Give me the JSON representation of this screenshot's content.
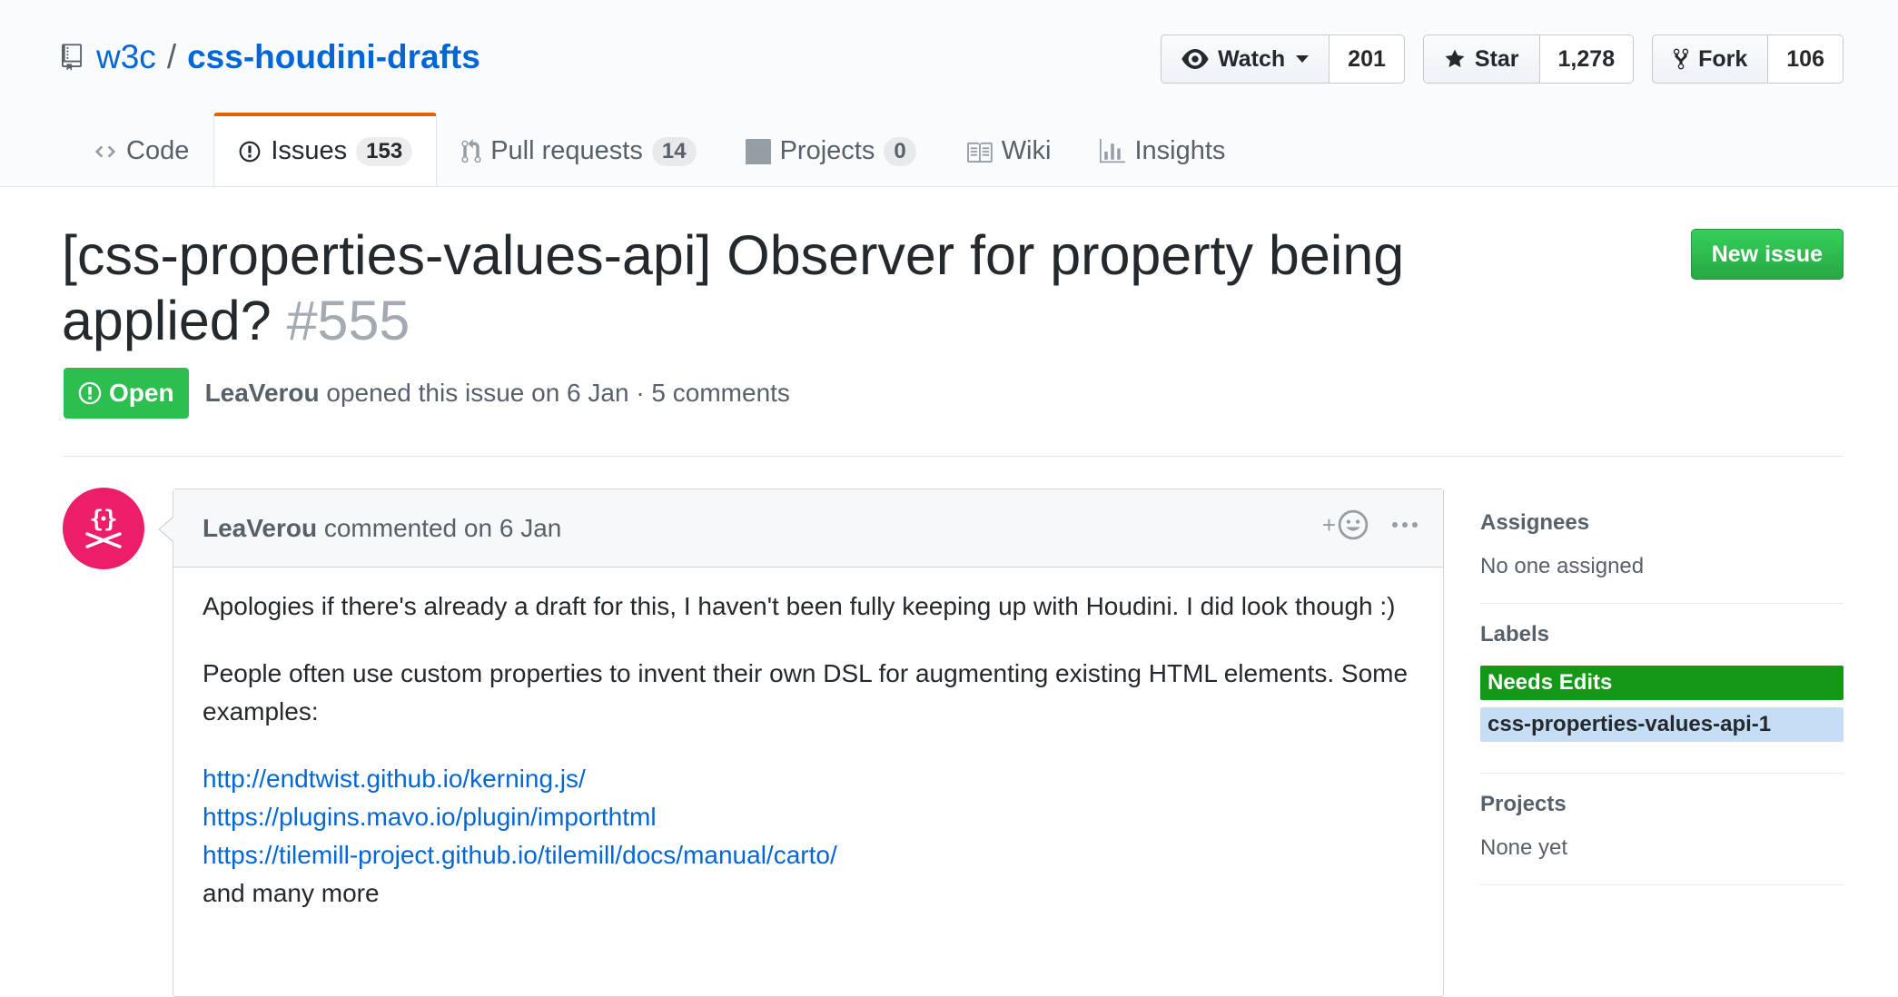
{
  "repo": {
    "owner": "w3c",
    "separator": "/",
    "name": "css-houdini-drafts"
  },
  "actions": {
    "watch": {
      "label": "Watch",
      "count": "201",
      "icon": "eye-icon"
    },
    "star": {
      "label": "Star",
      "count": "1,278",
      "icon": "star-icon"
    },
    "fork": {
      "label": "Fork",
      "count": "106",
      "icon": "fork-icon"
    }
  },
  "tabs": [
    {
      "label": "Code",
      "count": null,
      "icon": "code-icon",
      "selected": false
    },
    {
      "label": "Issues",
      "count": "153",
      "icon": "issue-opened-icon",
      "selected": true
    },
    {
      "label": "Pull requests",
      "count": "14",
      "icon": "pull-request-icon",
      "selected": false
    },
    {
      "label": "Projects",
      "count": "0",
      "icon": "project-icon",
      "selected": false
    },
    {
      "label": "Wiki",
      "count": null,
      "icon": "book-icon",
      "selected": false
    },
    {
      "label": "Insights",
      "count": null,
      "icon": "graph-icon",
      "selected": false
    }
  ],
  "issue": {
    "title": "[css-properties-values-api] Observer for property being applied?",
    "number": "#555",
    "state": "Open",
    "author": "LeaVerou",
    "meta_rest": "opened this issue on 6 Jan · 5 comments",
    "new_issue_label": "New issue"
  },
  "comment": {
    "author": "LeaVerou",
    "meta": "commented on 6 Jan",
    "reaction_plus": "+",
    "paragraphs": [
      "Apologies if there's already a draft for this, I haven't been fully keeping up with Houdini. I did look though :)",
      "People often use custom properties to invent their own DSL for augmenting existing HTML elements. Some examples:"
    ],
    "links": [
      "http://endtwist.github.io/kerning.js/",
      "https://plugins.mavo.io/plugin/importhtml",
      "https://tilemill-project.github.io/tilemill/docs/manual/carto/"
    ],
    "trailing": "and many more"
  },
  "sidebar": {
    "assignees": {
      "heading": "Assignees",
      "value": "No one assigned"
    },
    "labels": {
      "heading": "Labels",
      "items": [
        {
          "name": "Needs Edits",
          "bg": "#159818",
          "fg": "#ffffff"
        },
        {
          "name": "css-properties-values-api-1",
          "bg": "#c5def5",
          "fg": "#24292e"
        }
      ]
    },
    "projects": {
      "heading": "Projects",
      "value": "None yet"
    }
  },
  "colors": {
    "link": "#0366d6",
    "open_green": "#2cbe4e",
    "selected_tab_accent": "#e36209",
    "avatar_bg": "#ec1d69"
  }
}
